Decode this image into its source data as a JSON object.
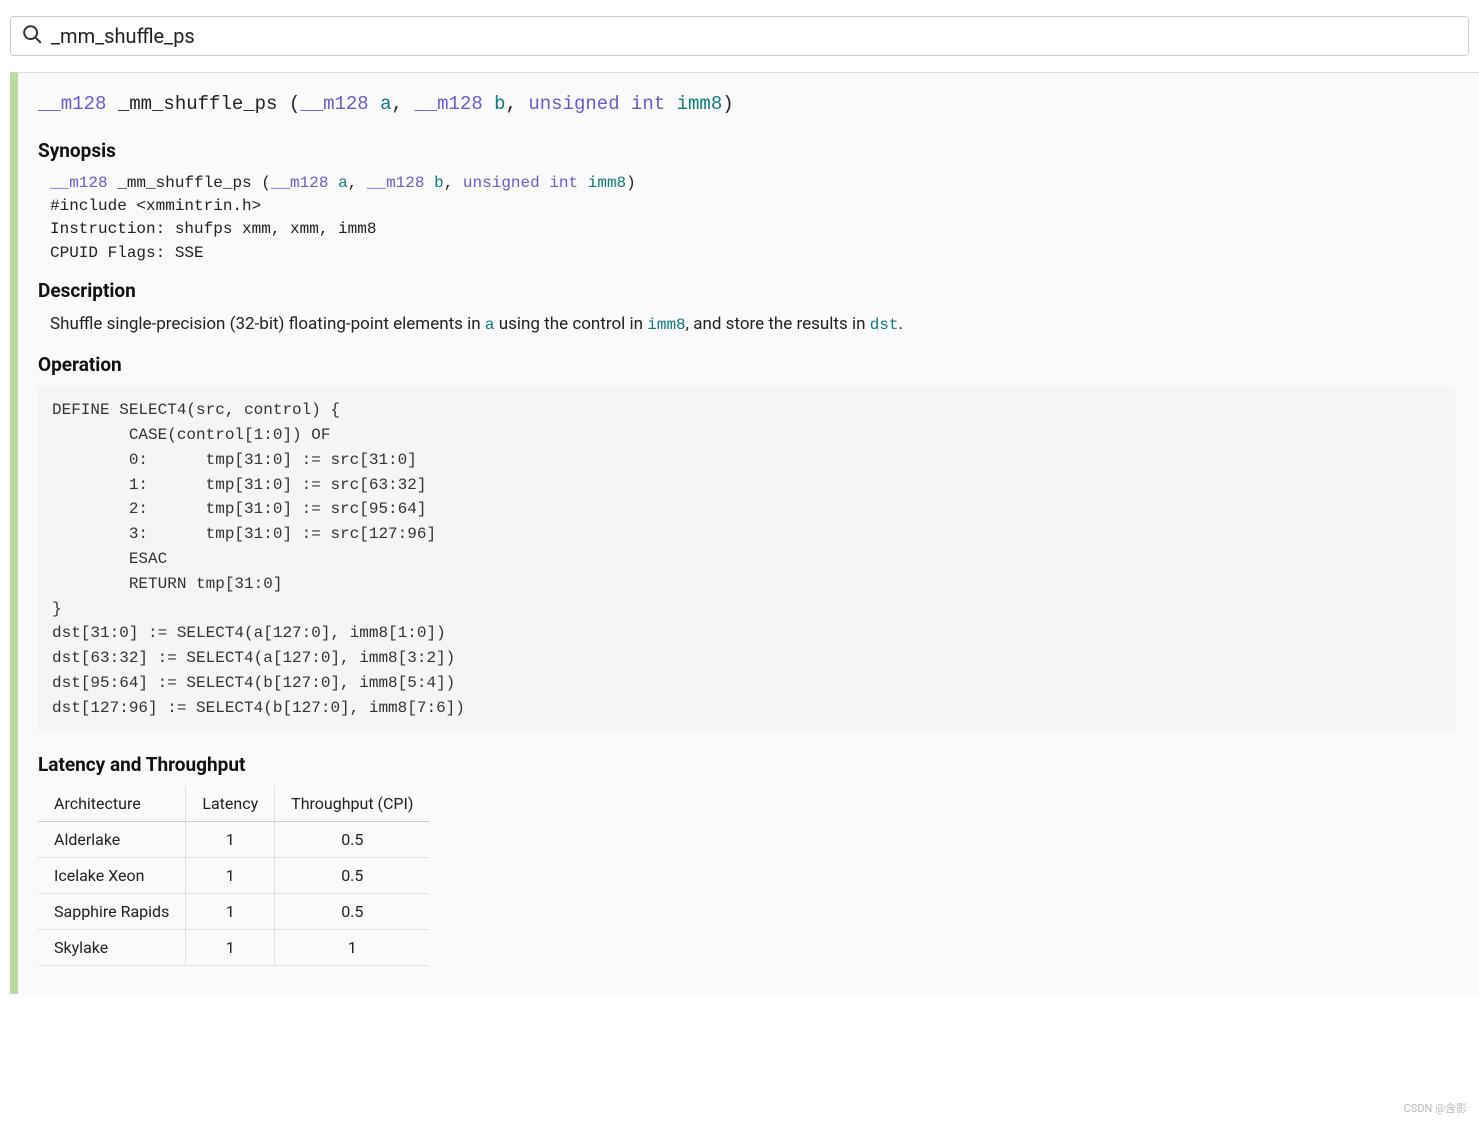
{
  "search": {
    "value": "_mm_shuffle_ps"
  },
  "signature": {
    "ret_type": "__m128",
    "name": "_mm_shuffle_ps",
    "params": [
      {
        "type": "__m128",
        "name": "a"
      },
      {
        "type": "__m128",
        "name": "b"
      },
      {
        "type": "unsigned int",
        "name": "imm8"
      }
    ]
  },
  "sections": {
    "synopsis_heading": "Synopsis",
    "description_heading": "Description",
    "operation_heading": "Operation",
    "perf_heading": "Latency and Throughput"
  },
  "synopsis": {
    "include_line": "#include <xmmintrin.h>",
    "instruction_line": "Instruction: shufps xmm, xmm, imm8",
    "cpuid_line": "CPUID Flags: SSE"
  },
  "description": {
    "prefix": "Shuffle single-precision (32-bit) floating-point elements in ",
    "code_a": "a",
    "mid1": " using the control in ",
    "code_imm8": "imm8",
    "mid2": ", and store the results in ",
    "code_dst": "dst",
    "suffix": "."
  },
  "operation_code": "DEFINE SELECT4(src, control) {\n        CASE(control[1:0]) OF\n        0:      tmp[31:0] := src[31:0]\n        1:      tmp[31:0] := src[63:32]\n        2:      tmp[31:0] := src[95:64]\n        3:      tmp[31:0] := src[127:96]\n        ESAC\n        RETURN tmp[31:0]\n}\ndst[31:0] := SELECT4(a[127:0], imm8[1:0])\ndst[63:32] := SELECT4(a[127:0], imm8[3:2])\ndst[95:64] := SELECT4(b[127:0], imm8[5:4])\ndst[127:96] := SELECT4(b[127:0], imm8[7:6])",
  "perf_table": {
    "headers": [
      "Architecture",
      "Latency",
      "Throughput (CPI)"
    ],
    "rows": [
      {
        "arch": "Alderlake",
        "latency": "1",
        "throughput": "0.5"
      },
      {
        "arch": "Icelake Xeon",
        "latency": "1",
        "throughput": "0.5"
      },
      {
        "arch": "Sapphire Rapids",
        "latency": "1",
        "throughput": "0.5"
      },
      {
        "arch": "Skylake",
        "latency": "1",
        "throughput": "1"
      }
    ]
  },
  "watermark": "CSDN @含影"
}
